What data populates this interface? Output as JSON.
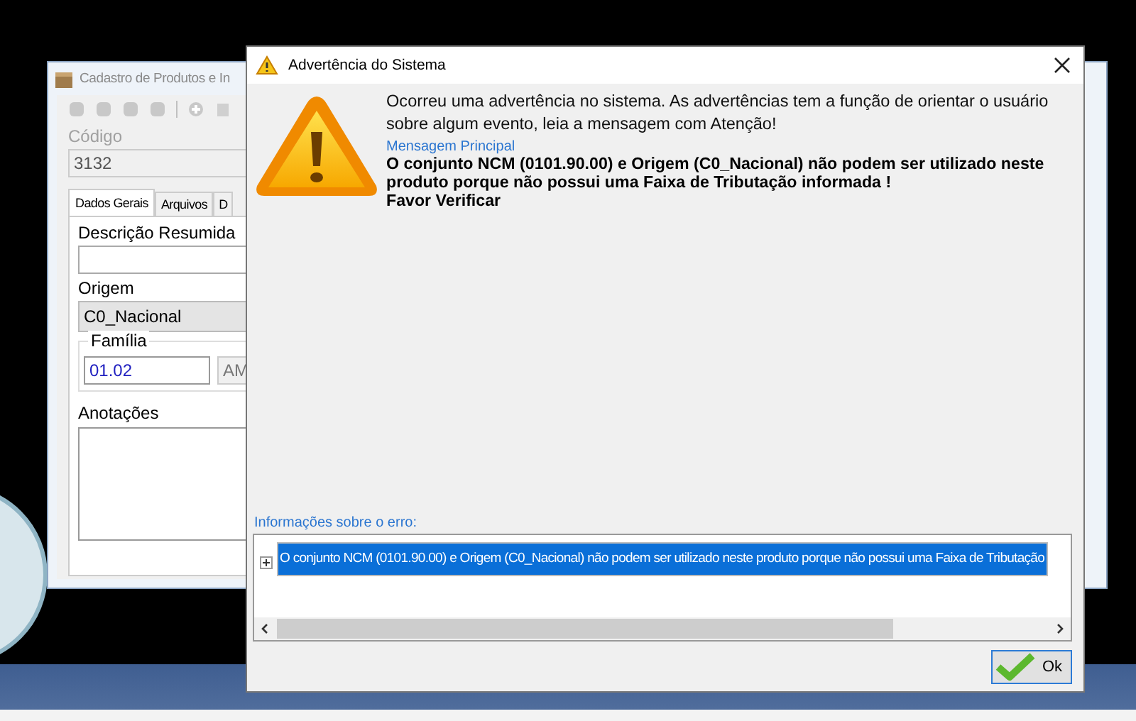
{
  "background_window": {
    "title": "Cadastro de Produtos e In",
    "codigo": {
      "label": "Código",
      "value": "3132",
      "disabled": true
    },
    "tabs": [
      {
        "label": "Dados Gerais",
        "selected": true
      },
      {
        "label": "Arquivos",
        "selected": false
      },
      {
        "label": "D",
        "selected": false
      }
    ],
    "descricao": {
      "label": "Descrição Resumida"
    },
    "origem": {
      "label": "Origem",
      "value": "C0_Nacional"
    },
    "familia": {
      "label": "Família",
      "code": "01.02",
      "name": "AM"
    },
    "anotacoes": {
      "label": "Anotações"
    }
  },
  "dialog": {
    "title": "Advertência do Sistema",
    "intro": "Ocorreu uma advertência no sistema. As advertências tem a função de orientar o usuário sobre algum evento, leia a mensagem com Atenção!",
    "main_label": "Mensagem Principal",
    "main_message": [
      "O conjunto NCM (0101.90.00) e Origem (C0_Nacional) não podem ser utilizado neste produto porque não possui uma Faixa de Tributação informada !",
      "Favor Verificar"
    ],
    "details_label": "Informações sobre o erro:",
    "details": [
      {
        "text": "O conjunto NCM (0101.90.00) e Origem (C0_Nacional) não podem ser utilizado neste produto porque não possui uma Faixa de Tributação",
        "expanded": false,
        "selected": true
      }
    ],
    "ok_button": "Ok"
  }
}
